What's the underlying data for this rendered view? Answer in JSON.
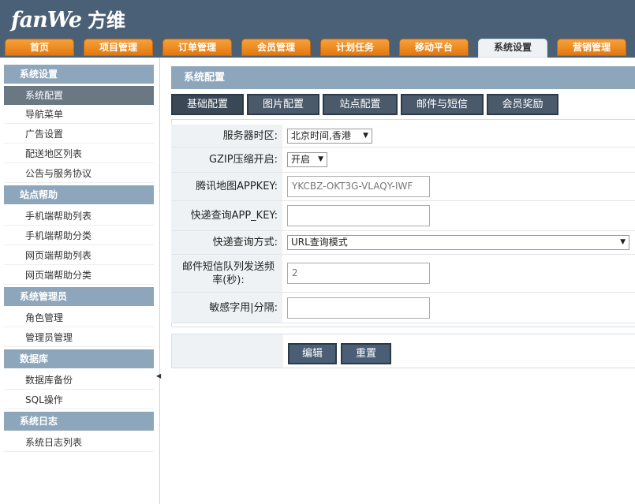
{
  "logo": {
    "en": "fanWe",
    "cn": "方维"
  },
  "nav": [
    "首页",
    "项目管理",
    "订单管理",
    "会员管理",
    "计划任务",
    "移动平台",
    "系统设置",
    "营销管理"
  ],
  "sidebar": {
    "groups": [
      {
        "title": "系统设置",
        "items": [
          "系统配置",
          "导航菜单",
          "广告设置",
          "配送地区列表",
          "公告与服务协议"
        ]
      },
      {
        "title": "站点帮助",
        "items": [
          "手机端帮助列表",
          "手机端帮助分类",
          "网页端帮助列表",
          "网页端帮助分类"
        ]
      },
      {
        "title": "系统管理员",
        "items": [
          "角色管理",
          "管理员管理"
        ]
      },
      {
        "title": "数据库",
        "items": [
          "数据库备份",
          "SQL操作"
        ]
      },
      {
        "title": "系统日志",
        "items": [
          "系统日志列表"
        ]
      }
    ],
    "toggle_icon": "◀"
  },
  "panel": {
    "title": "系统配置"
  },
  "subtabs": [
    "基础配置",
    "图片配置",
    "站点配置",
    "邮件与短信",
    "会员奖励"
  ],
  "form": {
    "timezone_label": "服务器时区:",
    "timezone_value": "北京时间,香港",
    "gzip_label": "GZIP压缩开启:",
    "gzip_value": "开启",
    "tencent_label": "腾讯地图APPKEY:",
    "tencent_value": "YKCBZ-OKT3G-VLAQY-IWF",
    "express_key_label": "快递查询APP_KEY:",
    "express_key_value": "",
    "express_mode_label": "快递查询方式:",
    "express_mode_value": "URL查询模式",
    "queue_label": "邮件短信队列发送频率(秒):",
    "queue_value": "2",
    "sensitive_label": "敏感字用|分隔:",
    "sensitive_value": ""
  },
  "buttons": {
    "edit": "编辑",
    "reset": "重置"
  },
  "icons": {
    "dropdown": "▼"
  }
}
